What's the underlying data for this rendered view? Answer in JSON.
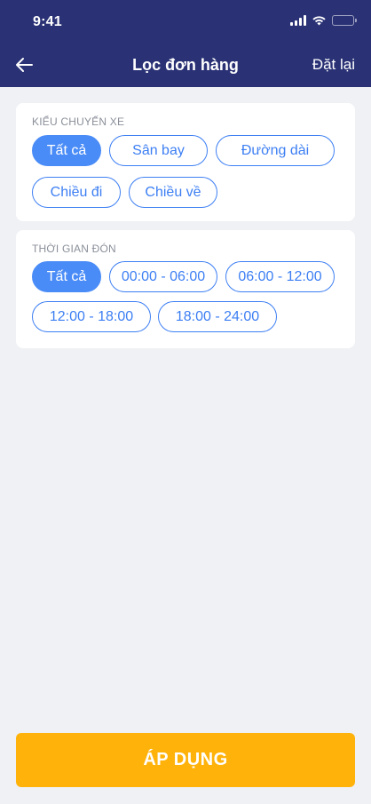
{
  "status_bar": {
    "time": "9:41",
    "icons": [
      "signal-icon",
      "wifi-icon",
      "battery-icon"
    ]
  },
  "nav": {
    "back_icon": "arrow-left-icon",
    "title": "Lọc đơn hàng",
    "reset_label": "Đặt lại"
  },
  "vehicle_type": {
    "label": "KIỂU CHUYẾN XE",
    "options": [
      "Tất cả",
      "Sân bay",
      "Đường dài",
      "Chiều đi",
      "Chiều về"
    ],
    "selected": "Tất cả"
  },
  "pickup_time": {
    "label": "THỜI GIAN ĐÓN",
    "options": [
      "Tất cả",
      "00:00 - 06:00",
      "06:00 - 12:00",
      "12:00 - 18:00",
      "18:00 - 24:00"
    ],
    "selected": "Tất cả"
  },
  "apply_label": "ÁP DỤNG",
  "colors": {
    "header_bg": "#2a3275",
    "accent_blue": "#4a8cf7",
    "apply_orange": "#ffb20a",
    "page_bg": "#eff1f4"
  }
}
